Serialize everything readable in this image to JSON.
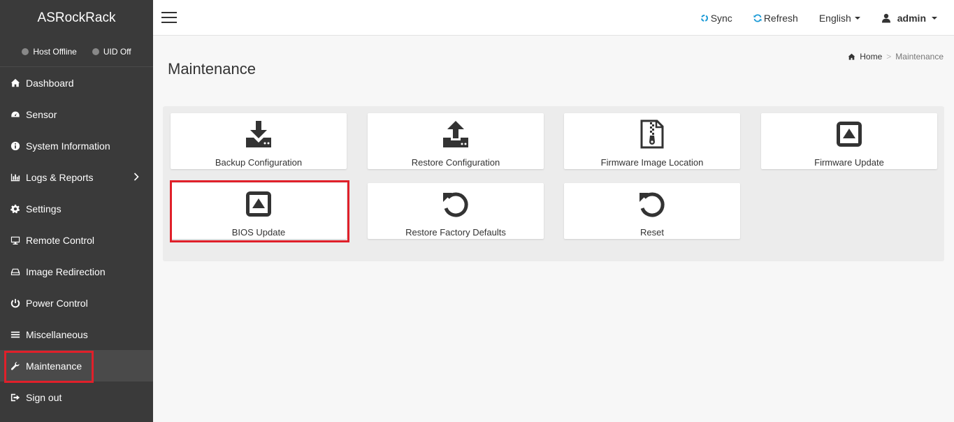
{
  "brand": "ASRockRack",
  "status": {
    "host": "Host Offline",
    "uid": "UID Off"
  },
  "sidebar": {
    "items": [
      {
        "label": "Dashboard",
        "icon": "home-icon"
      },
      {
        "label": "Sensor",
        "icon": "gauge-icon"
      },
      {
        "label": "System Information",
        "icon": "info-icon"
      },
      {
        "label": "Logs & Reports",
        "icon": "bar-chart-icon"
      },
      {
        "label": "Settings",
        "icon": "gear-icon"
      },
      {
        "label": "Remote Control",
        "icon": "monitor-icon"
      },
      {
        "label": "Image Redirection",
        "icon": "drive-icon"
      },
      {
        "label": "Power Control",
        "icon": "power-icon"
      },
      {
        "label": "Miscellaneous",
        "icon": "menu-icon"
      },
      {
        "label": "Maintenance",
        "icon": "wrench-icon",
        "active": true
      },
      {
        "label": "Sign out",
        "icon": "sign-out-icon"
      }
    ]
  },
  "topbar": {
    "sync": "Sync",
    "refresh": "Refresh",
    "language": "English",
    "user": "admin",
    "accent": "#1a9ad6"
  },
  "page": {
    "title": "Maintenance",
    "breadcrumb_home": "Home",
    "breadcrumb_sep": ">",
    "breadcrumb_current": "Maintenance"
  },
  "tiles": [
    {
      "label": "Backup Configuration",
      "icon": "download-icon"
    },
    {
      "label": "Restore Configuration",
      "icon": "upload-icon"
    },
    {
      "label": "Firmware Image Location",
      "icon": "zip-file-icon"
    },
    {
      "label": "Firmware Update",
      "icon": "firmware-update-icon"
    },
    {
      "label": "BIOS Update",
      "icon": "bios-update-icon"
    },
    {
      "label": "Restore Factory Defaults",
      "icon": "undo-icon"
    },
    {
      "label": "Reset",
      "icon": "reset-icon"
    }
  ],
  "highlight_color": "#e0202a"
}
